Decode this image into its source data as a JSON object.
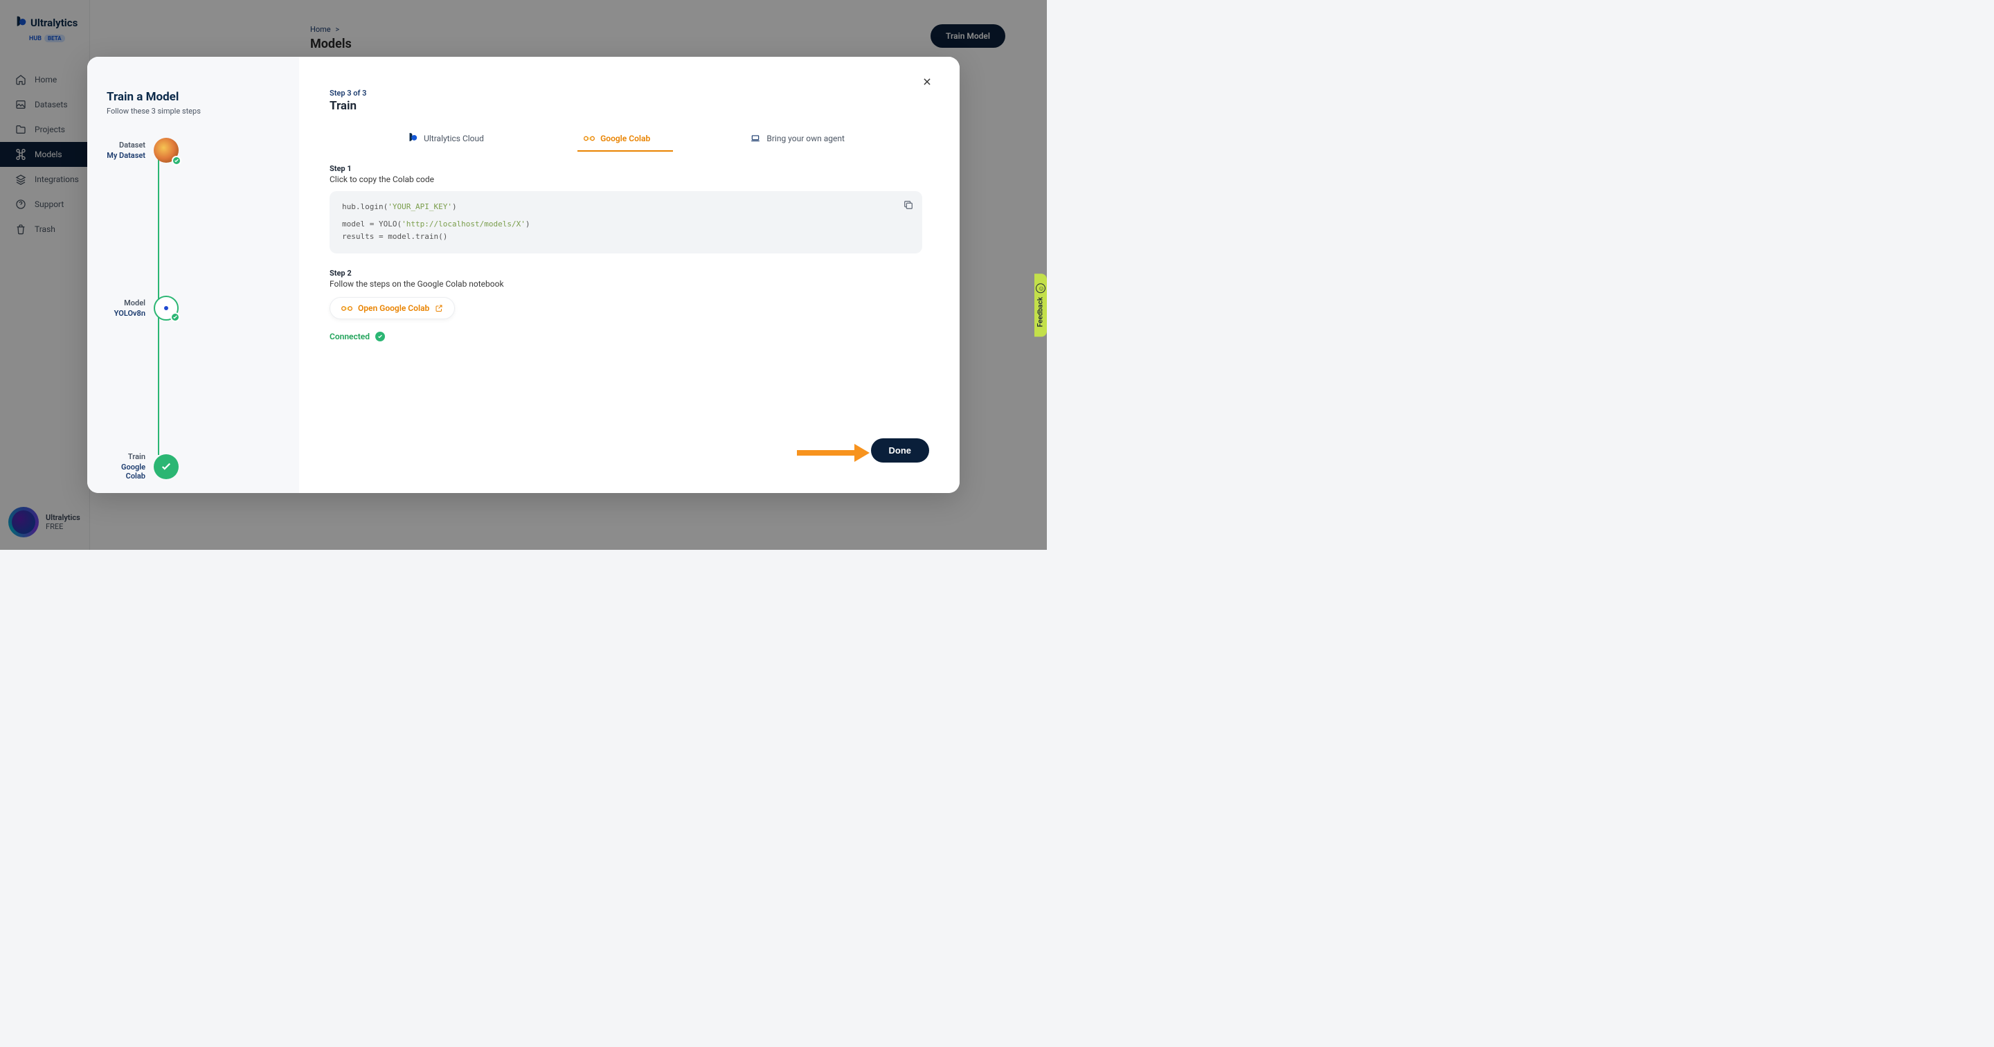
{
  "brand": {
    "name": "Ultralytics",
    "sub_hub": "HUB",
    "sub_beta": "BETA"
  },
  "sidebar": {
    "items": [
      {
        "label": "Home"
      },
      {
        "label": "Datasets"
      },
      {
        "label": "Projects"
      },
      {
        "label": "Models"
      },
      {
        "label": "Integrations"
      },
      {
        "label": "Support"
      },
      {
        "label": "Trash"
      }
    ],
    "footer_line1": "Ultralytics",
    "footer_line2": "FREE"
  },
  "header": {
    "breadcrumb_home": "Home",
    "breadcrumb_sep": ">",
    "title": "Models",
    "train_btn": "Train Model"
  },
  "modal": {
    "left": {
      "title": "Train a Model",
      "subtitle": "Follow these 3 simple steps",
      "steps": [
        {
          "name": "Dataset",
          "value": "My Dataset"
        },
        {
          "name": "Model",
          "value": "YOLOv8n"
        },
        {
          "name": "Train",
          "value": "Google Colab"
        }
      ]
    },
    "right": {
      "step_of": "Step 3 of 3",
      "title": "Train",
      "tabs": [
        {
          "label": "Ultralytics Cloud"
        },
        {
          "label": "Google Colab"
        },
        {
          "label": "Bring your own agent"
        }
      ],
      "step1_num": "Step 1",
      "step1_desc": "Click to copy the Colab code",
      "code": {
        "l1a": "hub.login(",
        "l1b": "'YOUR_API_KEY'",
        "l1c": ")",
        "l2a": "model = YOLO(",
        "l2b": "'http://localhost/models/X'",
        "l2c": ")",
        "l3": "results = model.train()"
      },
      "step2_num": "Step 2",
      "step2_desc": "Follow the steps on the Google Colab notebook",
      "open_colab": "Open Google Colab",
      "connected": "Connected",
      "done": "Done"
    }
  },
  "feedback": {
    "label": "Feedback"
  }
}
